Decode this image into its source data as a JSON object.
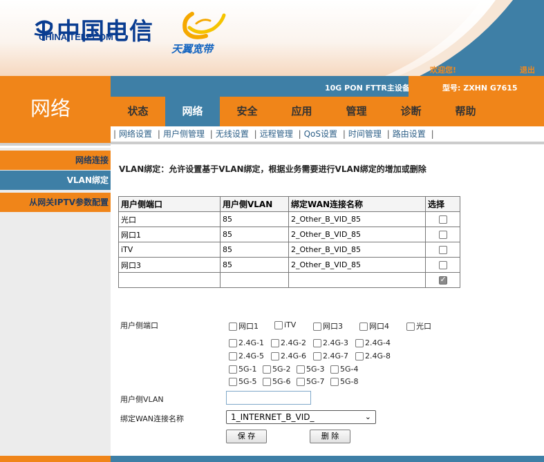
{
  "header": {
    "logo_cn": "中国电信",
    "logo_en": "CHINA TELECOM",
    "brand": "天翼宽带",
    "welcome": "欢迎您!",
    "logout": "退出"
  },
  "section_title": "网络",
  "device": {
    "name": "10G PON FTTR主设备",
    "model": "型号: ZXHN G7615"
  },
  "tabs": [
    "状态",
    "网络",
    "安全",
    "应用",
    "管理",
    "诊断",
    "帮助"
  ],
  "active_tab": "网络",
  "subnav": [
    "网络设置",
    "用户侧管理",
    "无线设置",
    "远程管理",
    "QoS设置",
    "时间管理",
    "路由设置"
  ],
  "sidebar": {
    "items": [
      "网络连接",
      "VLAN绑定",
      "从网关IPTV参数配置"
    ],
    "active": "VLAN绑定"
  },
  "page_desc": "VLAN绑定：允许设置基于VLAN绑定，根据业务需要进行VLAN绑定的增加或删除",
  "table": {
    "headers": [
      "用户侧端口",
      "用户侧VLAN",
      "绑定WAN连接名称",
      "选择"
    ],
    "rows": [
      {
        "port": "光口",
        "vlan": "85",
        "wan": "2_Other_B_VID_85",
        "checked": false
      },
      {
        "port": "网口1",
        "vlan": "85",
        "wan": "2_Other_B_VID_85",
        "checked": false
      },
      {
        "port": "iTV",
        "vlan": "85",
        "wan": "2_Other_B_VID_85",
        "checked": false
      },
      {
        "port": "网口3",
        "vlan": "85",
        "wan": "2_Other_B_VID_85",
        "checked": false
      },
      {
        "port": "",
        "vlan": "",
        "wan": "",
        "checked": true
      }
    ]
  },
  "form": {
    "port_label": "用户侧端口",
    "lan_ports": [
      "网口1",
      "iTV",
      "网口3",
      "网口4",
      "光口"
    ],
    "wifi_24_row1": [
      "2.4G-1",
      "2.4G-2",
      "2.4G-3",
      "2.4G-4"
    ],
    "wifi_24_row2": [
      "2.4G-5",
      "2.4G-6",
      "2.4G-7",
      "2.4G-8"
    ],
    "wifi_5_row1": [
      "5G-1",
      "5G-2",
      "5G-3",
      "5G-4"
    ],
    "wifi_5_row2": [
      "5G-5",
      "5G-6",
      "5G-7",
      "5G-8"
    ],
    "vlan_label": "用户侧VLAN",
    "vlan_value": "",
    "wan_label": "绑定WAN连接名称",
    "wan_selected": "1_INTERNET_B_VID_",
    "save_label": "保 存",
    "delete_label": "删 除"
  },
  "colors": {
    "orange": "#f08519",
    "blue": "#3e7fa6"
  }
}
